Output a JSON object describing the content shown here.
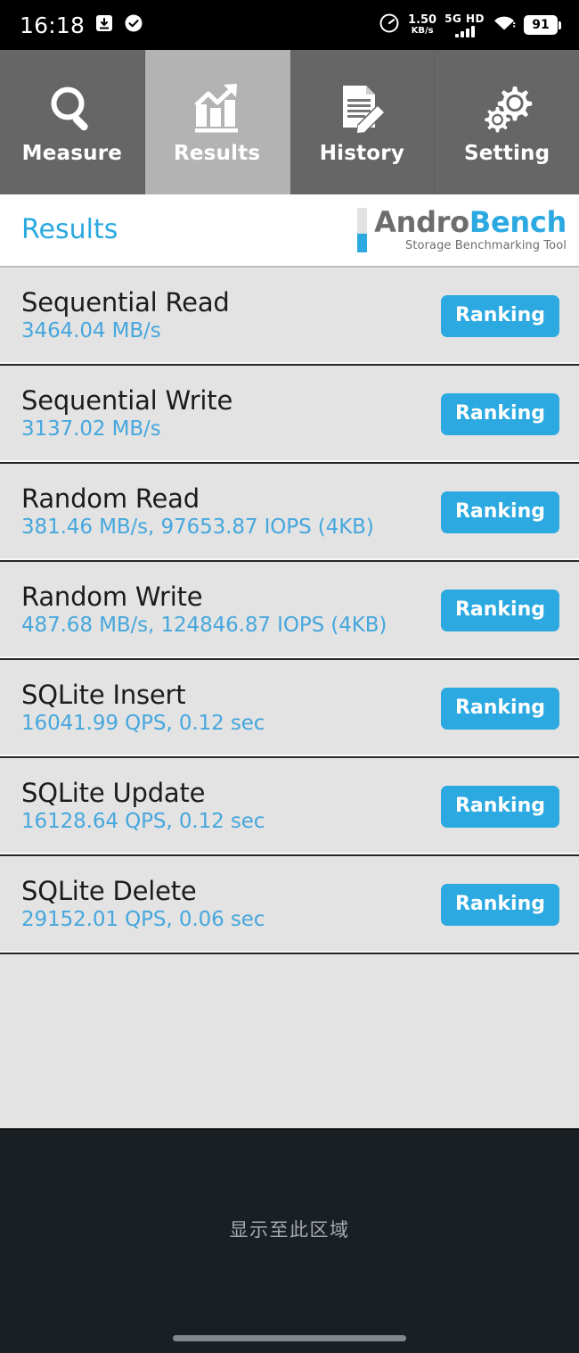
{
  "statusbar": {
    "time": "16:18",
    "left_icons": [
      "inbox-download-icon",
      "check-circle-icon"
    ],
    "net_speed_value": "1.50",
    "net_speed_unit": "KB/s",
    "network_type": "5G HD",
    "signal_bars": 4,
    "wifi_icon": "wifi-icon",
    "battery_percent": "91"
  },
  "tabs": [
    {
      "id": "measure",
      "label": "Measure",
      "icon": "magnifier-icon",
      "active": false
    },
    {
      "id": "results",
      "label": "Results",
      "icon": "bar-chart-arrow-icon",
      "active": true
    },
    {
      "id": "history",
      "label": "History",
      "icon": "document-pencil-icon",
      "active": false
    },
    {
      "id": "setting",
      "label": "Setting",
      "icon": "gears-icon",
      "active": false
    }
  ],
  "header": {
    "title": "Results",
    "logo_main_first": "Andro",
    "logo_main_second": "Bench",
    "logo_subtitle": "Storage Benchmarking Tool"
  },
  "results": [
    {
      "title": "Sequential Read",
      "value": "3464.04 MB/s",
      "button": "Ranking"
    },
    {
      "title": "Sequential Write",
      "value": "3137.02 MB/s",
      "button": "Ranking"
    },
    {
      "title": "Random Read",
      "value": "381.46 MB/s, 97653.87 IOPS (4KB)",
      "button": "Ranking"
    },
    {
      "title": "Random Write",
      "value": "487.68 MB/s, 124846.87 IOPS (4KB)",
      "button": "Ranking"
    },
    {
      "title": "SQLite Insert",
      "value": "16041.99 QPS, 0.12 sec",
      "button": "Ranking"
    },
    {
      "title": "SQLite Update",
      "value": "16128.64 QPS, 0.12 sec",
      "button": "Ranking"
    },
    {
      "title": "SQLite Delete",
      "value": "29152.01 QPS, 0.06 sec",
      "button": "Ranking"
    }
  ],
  "bottom": {
    "hint_text": "显示至此区域"
  },
  "colors": {
    "accent_blue": "#2ba9e0",
    "value_blue": "#46a7dd",
    "tab_inactive": "#666666",
    "tab_active": "#b3b3b3",
    "row_background": "#e3e3e3",
    "bottom_background": "#1a1f23"
  }
}
